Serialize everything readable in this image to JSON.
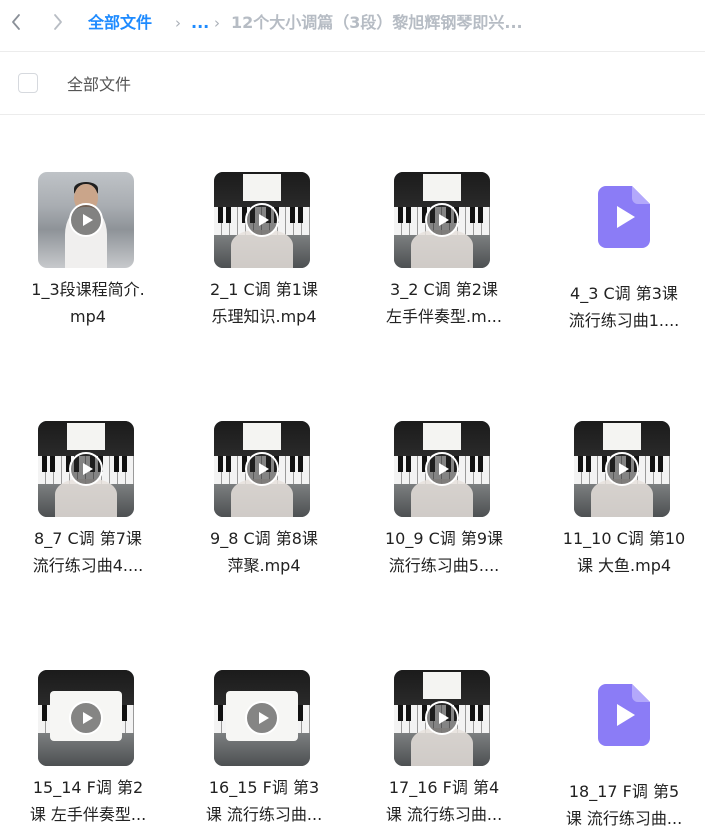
{
  "breadcrumb": {
    "root": "全部文件",
    "ellipsis": "...",
    "current": "12个大小调篇（3段）黎旭辉钢琴即兴..."
  },
  "select_all_label": "全部文件",
  "files": [
    {
      "line1": "1_3段课程简介.",
      "line2": "mp4",
      "thumb": "person"
    },
    {
      "line1": "2_1 C调 第1课",
      "line2": "乐理知识.mp4",
      "thumb": "piano"
    },
    {
      "line1": "3_2 C调 第2课",
      "line2": "左手伴奏型.m...",
      "thumb": "piano"
    },
    {
      "line1": "4_3 C调 第3课",
      "line2": "流行练习曲1....",
      "thumb": "file"
    },
    {
      "line1": "8_7 C调 第7课",
      "line2": "流行练习曲4....",
      "thumb": "piano"
    },
    {
      "line1": "9_8 C调 第8课",
      "line2": "萍聚.mp4",
      "thumb": "piano"
    },
    {
      "line1": "10_9 C调 第9课",
      "line2": "流行练习曲5....",
      "thumb": "piano"
    },
    {
      "line1": "11_10 C调 第10",
      "line2": "课 大鱼.mp4",
      "thumb": "piano"
    },
    {
      "line1": "15_14 F调 第2",
      "line2": "课 左手伴奏型...",
      "thumb": "board"
    },
    {
      "line1": "16_15 F调 第3",
      "line2": "课 流行练习曲...",
      "thumb": "board"
    },
    {
      "line1": "17_16 F调 第4",
      "line2": "课 流行练习曲...",
      "thumb": "piano"
    },
    {
      "line1": "18_17 F调 第5",
      "line2": "课 流行练习曲...",
      "thumb": "file"
    }
  ],
  "icons": {
    "back": "chevron-left-icon",
    "forward": "chevron-right-icon",
    "play": "play-icon",
    "video_file": "video-file-icon"
  },
  "colors": {
    "accent": "#1e8bff",
    "crumb_inactive": "#b6bcc4",
    "file_icon": "#8b7cf6"
  }
}
